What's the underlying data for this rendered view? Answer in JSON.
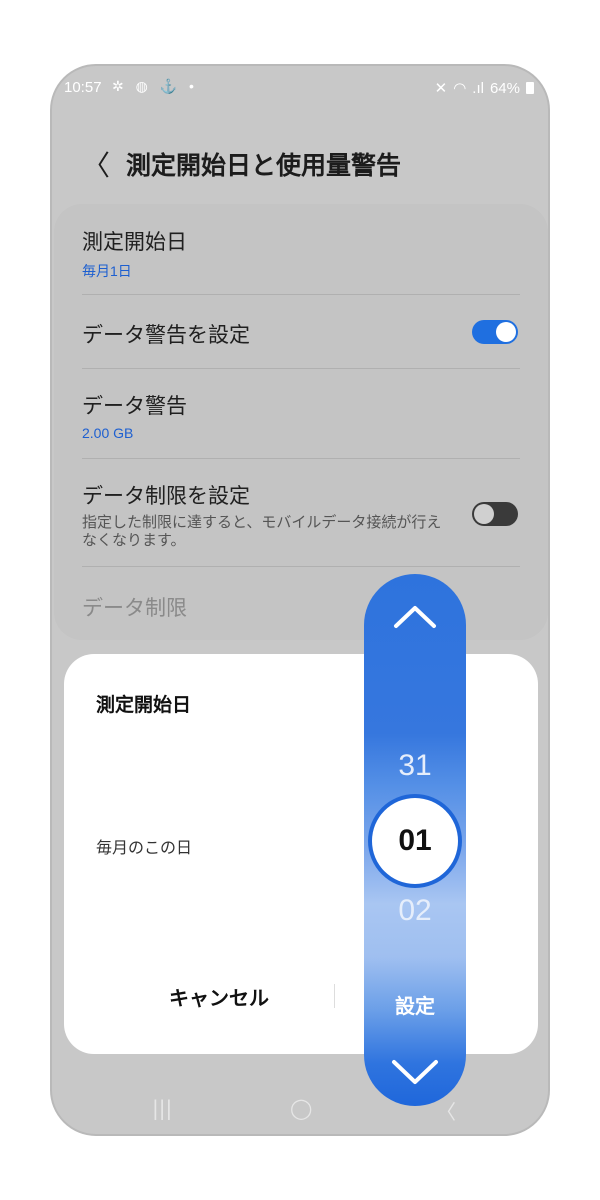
{
  "status": {
    "time": "10:57",
    "battery": "64%"
  },
  "header": {
    "back_glyph": "〈",
    "title": "測定開始日と使用量警告"
  },
  "settings": {
    "start_day": {
      "label": "測定開始日",
      "value": "毎月1日"
    },
    "data_warning_toggle": {
      "label": "データ警告を設定",
      "state": "on"
    },
    "data_warning": {
      "label": "データ警告",
      "value": "2.00 GB"
    },
    "data_limit_toggle": {
      "label": "データ制限を設定",
      "description": "指定した制限に達すると、モバイルデータ接続が行えなくなります。",
      "state": "off"
    },
    "data_limit": {
      "label": "データ制限"
    }
  },
  "dialog": {
    "title": "測定開始日",
    "label": "毎月のこの日",
    "cancel": "キャンセル",
    "confirm": "設定"
  },
  "picker": {
    "previous": "31",
    "selected": "01",
    "next": "02"
  },
  "colors": {
    "accent": "#1f6fe0",
    "link": "#1d5fd0"
  }
}
